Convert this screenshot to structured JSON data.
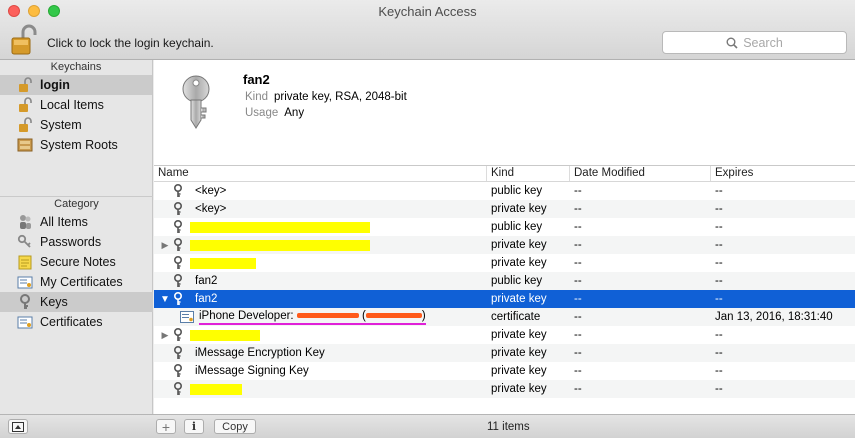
{
  "window": {
    "title": "Keychain Access"
  },
  "toolbar": {
    "lock_text": "Click to lock the login keychain.",
    "search_placeholder": "Search"
  },
  "sidebar": {
    "keychains_header": "Keychains",
    "keychains": [
      {
        "label": "login",
        "icon": "lock-open-icon",
        "selected": true
      },
      {
        "label": "Local Items",
        "icon": "lock-open-icon"
      },
      {
        "label": "System",
        "icon": "lock-open-icon"
      },
      {
        "label": "System Roots",
        "icon": "cabinet-icon"
      }
    ],
    "category_header": "Category",
    "categories": [
      {
        "label": "All Items",
        "icon": "people-icon"
      },
      {
        "label": "Passwords",
        "icon": "key-ring-icon"
      },
      {
        "label": "Secure Notes",
        "icon": "note-icon"
      },
      {
        "label": "My Certificates",
        "icon": "certificate-icon"
      },
      {
        "label": "Keys",
        "icon": "key-icon",
        "selected": true
      },
      {
        "label": "Certificates",
        "icon": "certificate-icon"
      }
    ]
  },
  "detail": {
    "name": "fan2",
    "kind_label": "Kind",
    "kind_value": "private key, RSA, 2048-bit",
    "usage_label": "Usage",
    "usage_value": "Any"
  },
  "table": {
    "columns": {
      "name": "Name",
      "kind": "Kind",
      "date": "Date Modified",
      "expires": "Expires"
    },
    "rows": [
      {
        "name": "<key>",
        "kind": "public key",
        "date": "--",
        "expires": "--"
      },
      {
        "name": "<key>",
        "kind": "private key",
        "date": "--",
        "expires": "--"
      },
      {
        "name": "",
        "kind": "public key",
        "date": "--",
        "expires": "--"
      },
      {
        "name": "",
        "kind": "private key",
        "date": "--",
        "expires": "--"
      },
      {
        "name": "",
        "kind": "private key",
        "date": "--",
        "expires": "--"
      },
      {
        "name": "fan2",
        "kind": "public key",
        "date": "--",
        "expires": "--"
      },
      {
        "name": "fan2",
        "kind": "private key",
        "date": "--",
        "expires": "--"
      },
      {
        "name": "iPhone Developer:",
        "name_suffix": "(",
        "name_end": ")",
        "kind": "certificate",
        "date": "--",
        "expires": "Jan 13, 2016, 18:31:40"
      },
      {
        "name": "",
        "kind": "private key",
        "date": "--",
        "expires": "--"
      },
      {
        "name": "iMessage Encryption Key",
        "kind": "private key",
        "date": "--",
        "expires": "--"
      },
      {
        "name": "iMessage Signing Key",
        "kind": "private key",
        "date": "--",
        "expires": "--"
      },
      {
        "name": "",
        "kind": "private key",
        "date": "--",
        "expires": "--"
      }
    ]
  },
  "bottom": {
    "add_label": "+",
    "info_label": "i",
    "copy_label": "Copy",
    "count": "11 items"
  },
  "colors": {
    "selection": "#1060d6",
    "redaction": "#ffff00",
    "scribble": "#ff5a1a",
    "annotation": "#e020d8"
  }
}
